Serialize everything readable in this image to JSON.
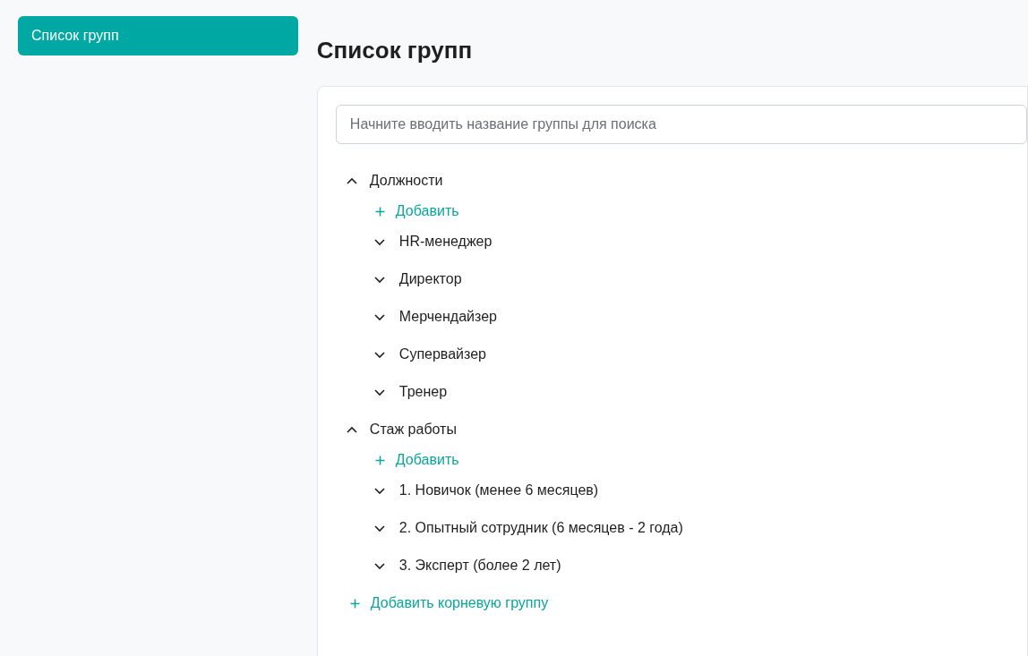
{
  "sidebar": {
    "items": [
      {
        "label": "Список групп",
        "selected": true
      }
    ]
  },
  "page": {
    "title": "Список групп"
  },
  "search": {
    "placeholder": "Начните вводить название группы для поиска"
  },
  "tree": [
    {
      "label": "Должности",
      "expanded": true,
      "add_label": "Добавить",
      "children": [
        {
          "label": "HR-менеджер",
          "expanded": false
        },
        {
          "label": "Директор",
          "expanded": false
        },
        {
          "label": "Мерчендайзер",
          "expanded": false
        },
        {
          "label": "Супервайзер",
          "expanded": false
        },
        {
          "label": "Тренер",
          "expanded": false
        }
      ]
    },
    {
      "label": "Стаж работы",
      "expanded": true,
      "add_label": "Добавить",
      "children": [
        {
          "label": "1. Новичок (менее 6 месяцев)",
          "expanded": false
        },
        {
          "label": "2. Опытный сотрудник (6 месяцев - 2 года)",
          "expanded": false
        },
        {
          "label": "3. Эксперт (более 2 лет)",
          "expanded": false
        }
      ]
    }
  ],
  "add_root": {
    "label": "Добавить корневую группу"
  }
}
